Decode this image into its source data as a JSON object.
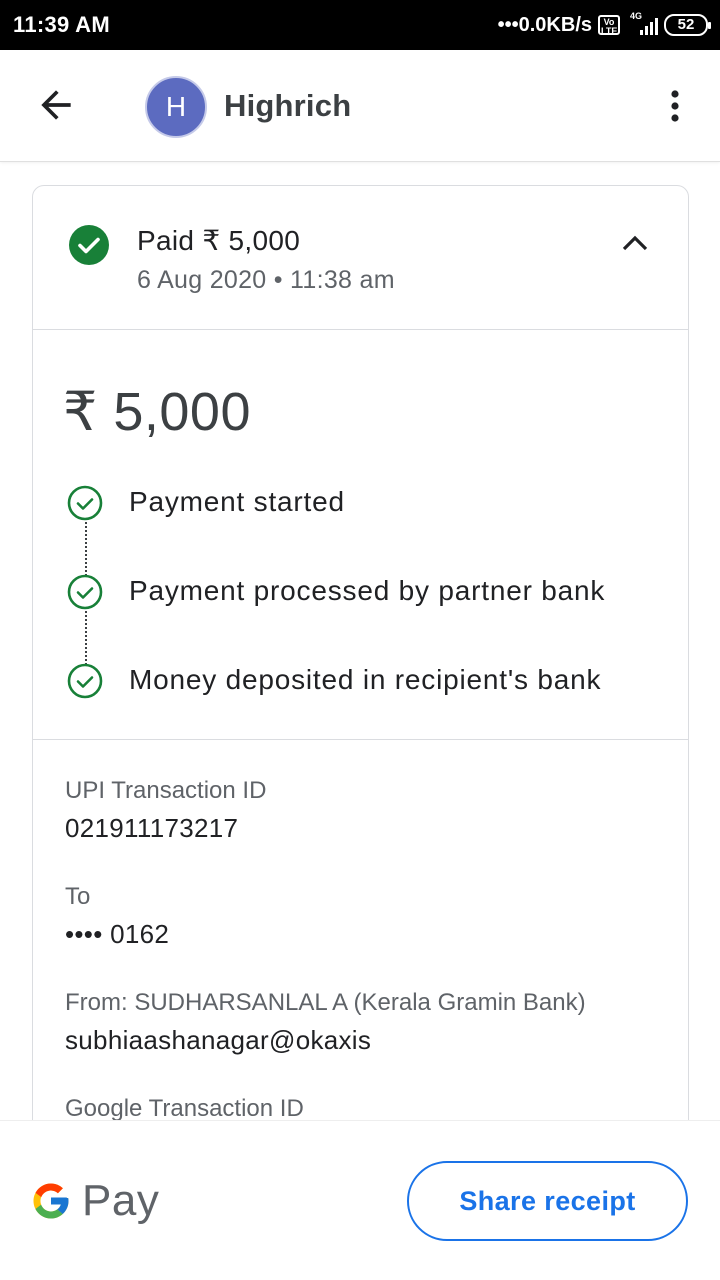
{
  "status_bar": {
    "time": "11:39 AM",
    "data_speed": "•••0.0KB/s",
    "volte_badge": "Vo LTE",
    "network_type": "4G",
    "battery": "52"
  },
  "header": {
    "avatar_initial": "H",
    "contact_name": "Highrich",
    "icons": {
      "back": "arrow-back-icon",
      "more": "more-vert-icon"
    }
  },
  "summary": {
    "title": "Paid ₹ 5,000",
    "subtitle": "6 Aug 2020 • 11:38 am"
  },
  "amount": "₹ 5,000",
  "steps": [
    {
      "label": "Payment started"
    },
    {
      "label": "Payment processed by partner bank"
    },
    {
      "label": "Money deposited in recipient's bank"
    }
  ],
  "details": {
    "upi_label": "UPI Transaction ID",
    "upi_value": "021911173217",
    "to_label": "To",
    "to_value": "•••• 0162",
    "from_label": "From: SUDHARSANLAL A (Kerala Gramin Bank)",
    "from_value": "subhiaashanagar@okaxis",
    "google_label": "Google Transaction ID"
  },
  "footer": {
    "brand": "Pay",
    "share_label": "Share receipt"
  },
  "colors": {
    "success_green": "#188038",
    "accent_blue": "#1a73e8",
    "avatar_bg": "#5c6bc0"
  }
}
